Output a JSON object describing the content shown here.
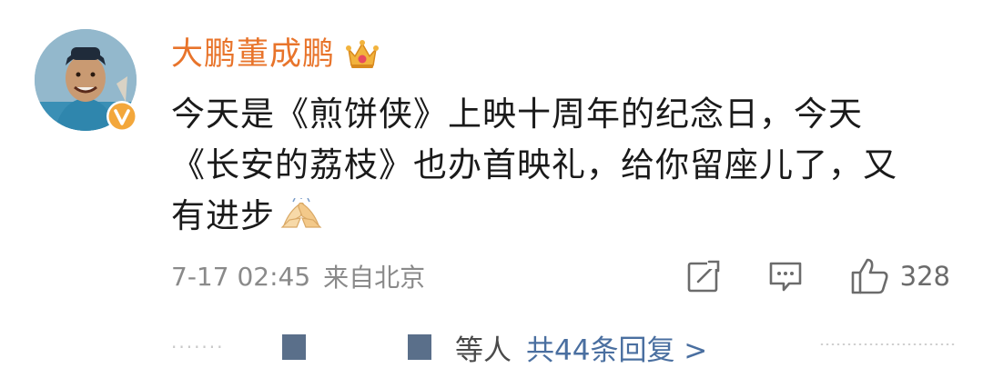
{
  "comment": {
    "username": "大鹏董成鹏",
    "content_lines": [
      "今天是《煎饼侠》上映十周年的纪念日，今天",
      "《长安的荔枝》也办首映礼，给你留座儿了，又",
      "有进步"
    ],
    "timestamp": "7-17 02:45",
    "source": "来自北京",
    "like_count": "328"
  },
  "replies": {
    "prefix_dots": "·······",
    "label": "等人",
    "count_link": "共44条回复 >"
  },
  "colors": {
    "username": "#e8742b",
    "link": "#4a6fa0",
    "meta": "#8a8a8a",
    "verified_badge": "#f3a73b"
  },
  "icons": {
    "verified": "verified-v-icon",
    "membership": "crown-icon",
    "emoji": "praying-hands-emoji-icon",
    "repost": "repost-icon",
    "comment": "comment-icon",
    "like": "thumbs-up-icon"
  }
}
